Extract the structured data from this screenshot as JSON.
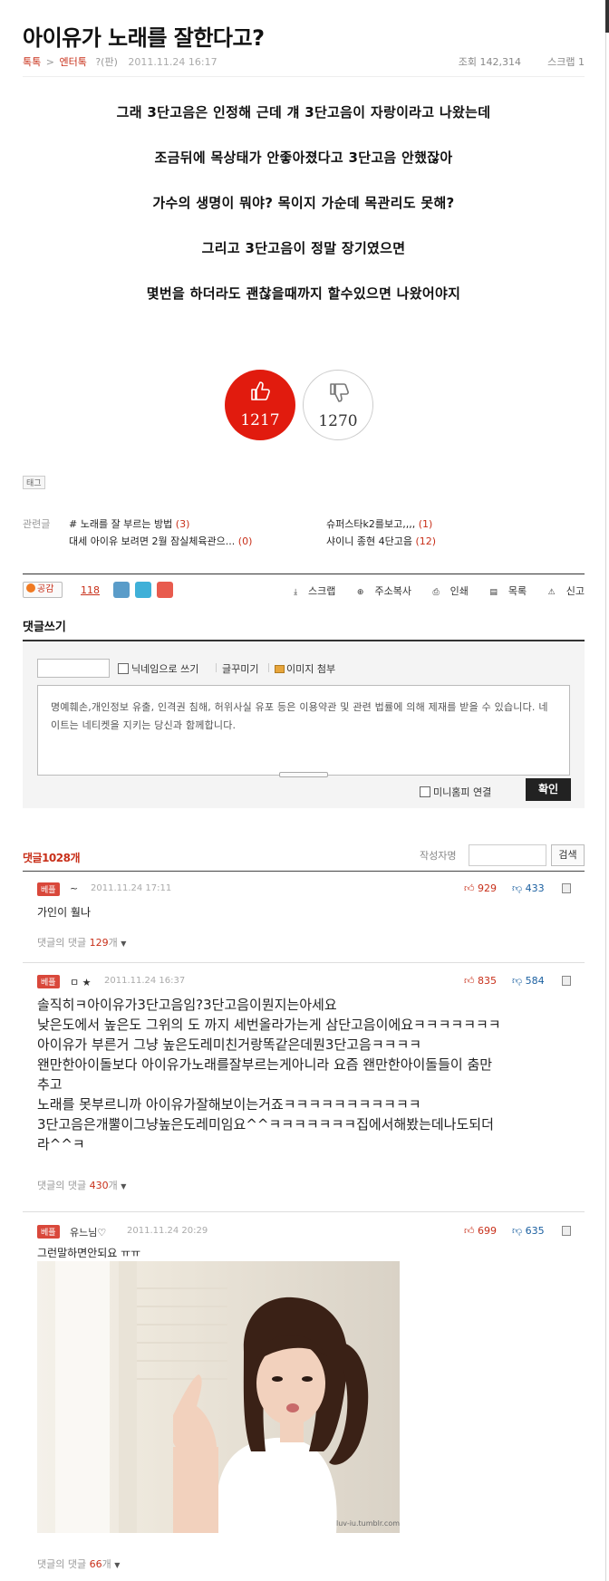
{
  "post": {
    "title": "아이유가 노래를 잘한다고?",
    "breadcrumb_board": "톡톡",
    "breadcrumb_sep": ">",
    "breadcrumb_category": "엔터톡",
    "author": "?(판)",
    "date": "2011.11.24 16:17",
    "views_label": "조회 142,314",
    "scrap_label": "스크랩 1",
    "body": [
      "그래 3단고음은 인정해 근데 걔 3단고음이 자랑이라고 나왔는데",
      "조금뒤에 목상태가 안좋아졌다고 3단고음 안했잖아",
      "가수의 생명이 뭐야? 목이지 가순데 목관리도 못해?",
      "그리고 3단고음이 정말 장기였으면",
      "몇번을 하더라도 괜찮을때까지 할수있으면 나왔어야지"
    ],
    "vote_up": "1217",
    "vote_down": "1270",
    "tag_label": "태그",
    "related_label": "관련글",
    "related": [
      {
        "title": "# 노래를 잘 부르는 방법",
        "count": "(3)"
      },
      {
        "title": "대세 아이유 보려면 2월 잠실체육관으...",
        "count": "(0)"
      },
      {
        "title": "슈퍼스타k2를보고,,,,",
        "count": "(1)"
      },
      {
        "title": "샤이니 종현 4단고음",
        "count": "(12)"
      }
    ]
  },
  "actions": {
    "empathy_label": "공감",
    "empathy_count": "118",
    "scrap": "스크랩",
    "copy_url": "주소복사",
    "print": "인쇄",
    "list": "목록",
    "report": "신고"
  },
  "write": {
    "title": "댓글쓰기",
    "nickname_checkbox": "닉네임으로 쓰기",
    "decorate": "글꾸미기",
    "attach_image": "이미지 첨부",
    "notice": "명예훼손,개인정보 유출, 인격권 침해, 허위사실 유포 등은 이용약관 및 관련 법률에 의해 제재를 받을 수 있습니다. 네이트는 네티켓을 지키는 당신과 함께합니다.",
    "mini_homepage": "미니홈피 연결",
    "submit": "확인"
  },
  "comments_header": {
    "title": "댓글1028개",
    "author_search_label": "작성자명",
    "search_button": "검색"
  },
  "comments": [
    {
      "badge": "베플",
      "author": "~",
      "date": "2011.11.24 17:11",
      "up": "929",
      "down": "433",
      "text": "가인이 훨나",
      "reply_prefix": "댓글의 댓글",
      "reply_count": "129",
      "reply_suffix": "개"
    },
    {
      "badge": "베플",
      "author": "ㅁ ★",
      "date": "2011.11.24 16:37",
      "up": "835",
      "down": "584",
      "lines": [
        "솔직히ㅋ아이유가3단고음임?3단고음이뭔지는아세요",
        "낮은도에서 높은도 그위의 도  까지 세번올라가는게 삼단고음이에요ㅋㅋㅋㅋㅋㅋㅋ",
        "아이유가 부른거 그냥 높은도레미친거랑똑같은데뭔3단고음ㅋㅋㅋㅋ",
        "왠만한아이돌보다 아이유가노래를잘부르는게아니라 요즘 왠만한아이돌들이 춤만",
        "추고",
        "노래를 못부르니까 아이유가잘해보이는거죠ㅋㅋㅋㅋㅋㅋㅋㅋㅋㅋㅋ",
        "3단고음은개뿔이그냥높은도레미임요^^ㅋㅋㅋㅋㅋㅋㅋ집에서해봤는데나도되더",
        "라^^ㅋ"
      ],
      "reply_prefix": "댓글의 댓글",
      "reply_count": "430",
      "reply_suffix": "개"
    },
    {
      "badge": "베플",
      "author": "유느님♡",
      "date": "2011.11.24 20:29",
      "up": "699",
      "down": "635",
      "text": "그런말하면안되요 ㅠㅠ",
      "image_watermark": "luv-iu.tumblr.com",
      "reply_prefix": "댓글의 댓글",
      "reply_count": "66",
      "reply_suffix": "개"
    }
  ],
  "colors": {
    "accent": "#c8301a",
    "vote_up_bg": "#e11b0e",
    "badge": "#d9483b",
    "down_blue": "#1a5fa0"
  }
}
